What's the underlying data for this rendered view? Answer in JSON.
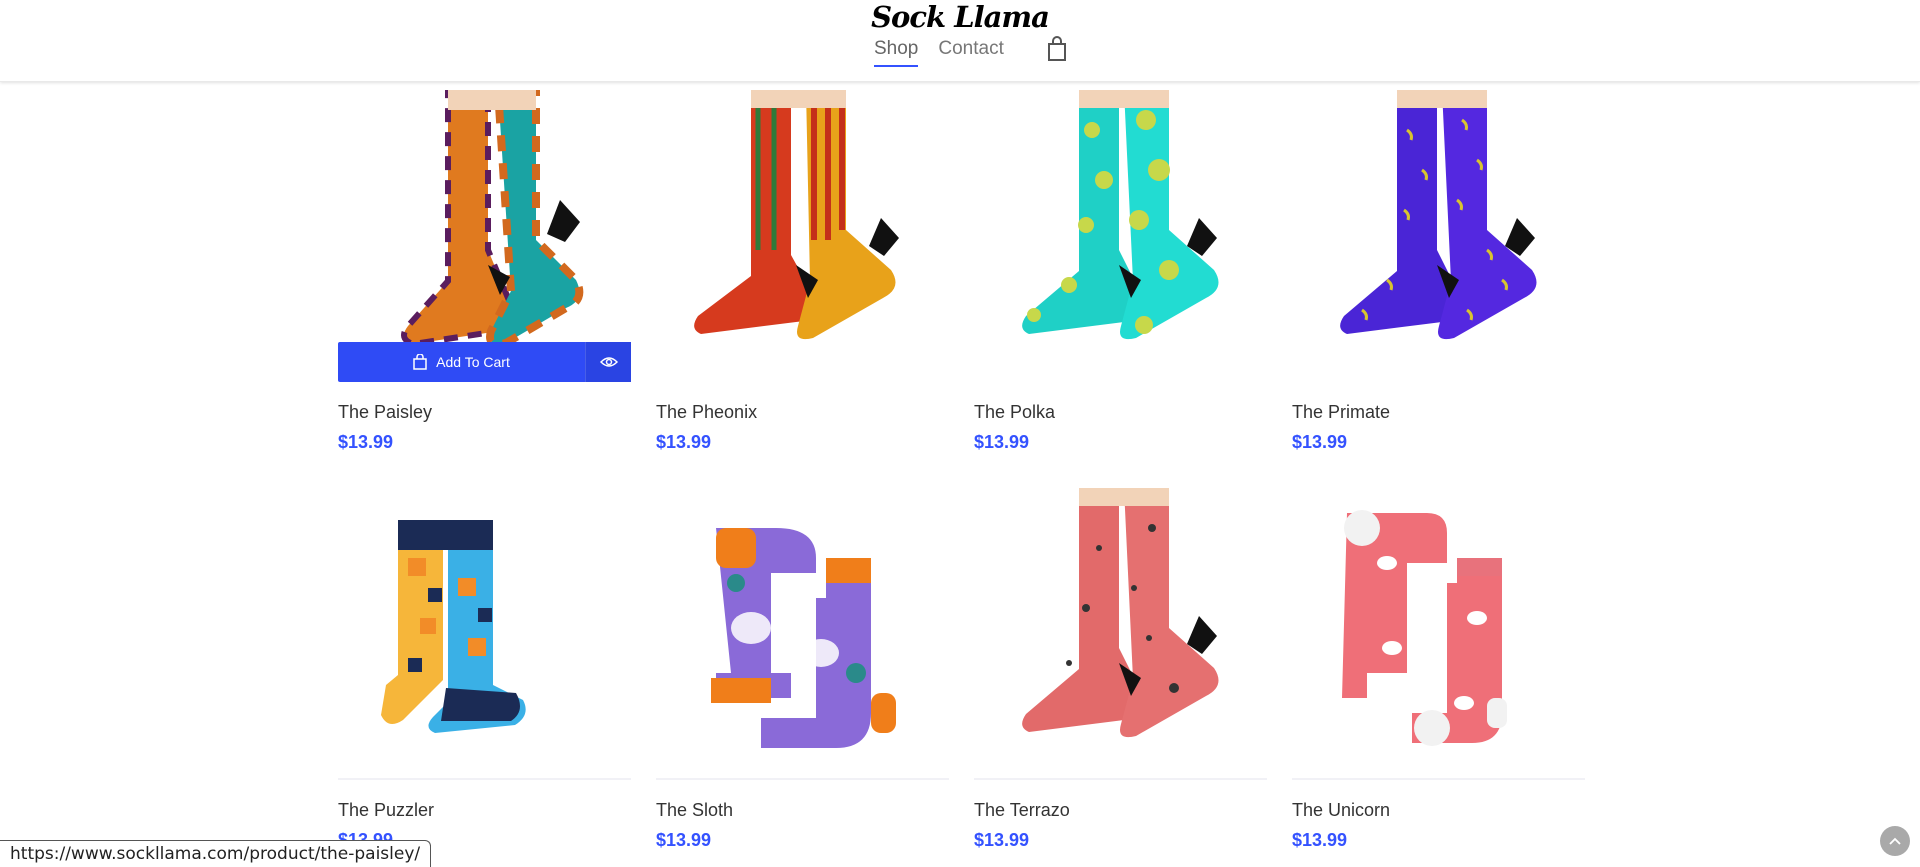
{
  "header": {
    "logo": "Sock Llama",
    "nav": [
      {
        "label": "Shop",
        "active": true
      },
      {
        "label": "Contact",
        "active": false
      }
    ],
    "cart_icon": "shopping-bag-icon"
  },
  "product_actions": {
    "add_to_cart_label": "Add To Cart",
    "quick_view_icon": "eye-icon"
  },
  "products": [
    {
      "name": "The Paisley",
      "price": "$13.99"
    },
    {
      "name": "The Pheonix",
      "price": "$13.99"
    },
    {
      "name": "The Polka",
      "price": "$13.99"
    },
    {
      "name": "The Primate",
      "price": "$13.99"
    },
    {
      "name": "The Puzzler",
      "price": "$13.99"
    },
    {
      "name": "The Sloth",
      "price": "$13.99"
    },
    {
      "name": "The Terrazo",
      "price": "$13.99"
    },
    {
      "name": "The Unicorn",
      "price": "$13.99"
    }
  ],
  "status_bar": {
    "url": "https://www.sockllama.com/product/the-paisley/"
  },
  "colors": {
    "accent": "#3452ff",
    "price": "#3452ff"
  }
}
